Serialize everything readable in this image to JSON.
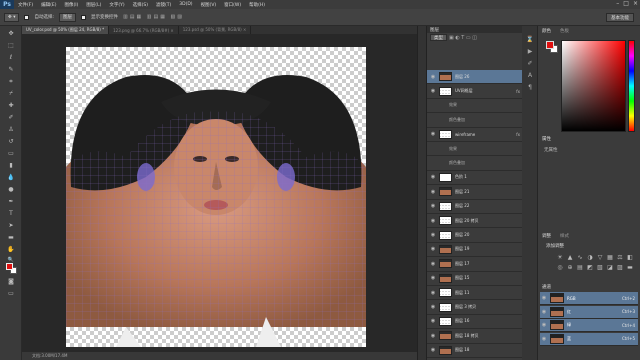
{
  "menubar": {
    "logo": "Ps",
    "items": [
      "文件(F)",
      "编辑(E)",
      "图像(I)",
      "图层(L)",
      "文字(Y)",
      "选择(S)",
      "滤镜(T)",
      "3D(D)",
      "视图(V)",
      "窗口(W)",
      "帮助(H)"
    ]
  },
  "options": {
    "auto_select": "自动选择:",
    "auto_select_target": "图层",
    "show_transform": "显示变换控件",
    "essentials": "基本功能"
  },
  "tabs": [
    {
      "label": "UV_color.psd @ 50% (图层 24, RGB/8) *",
      "active": true
    },
    {
      "label": "123.png @ 66.7% (RGB/8#) ×",
      "active": false
    },
    {
      "label": "123.psd @ 50% (背景, RGB/8) ×",
      "active": false
    }
  ],
  "status": {
    "doc_size": "文档:3.00M/17.4M"
  },
  "layers_panel": {
    "title": "图层",
    "filter_label": "类型",
    "layers": [
      {
        "name": "图层 26",
        "thumb": "face",
        "fx": "",
        "selected": true
      },
      {
        "name": "UV网格层",
        "thumb": "chk",
        "fx": "fx"
      },
      {
        "name": "效果",
        "thumb": "",
        "fx": "",
        "sub": true
      },
      {
        "name": "颜色叠加",
        "thumb": "",
        "fx": "",
        "sub": true
      },
      {
        "name": "wireframe",
        "thumb": "chk",
        "fx": "fx"
      },
      {
        "name": "效果",
        "thumb": "",
        "fx": "",
        "sub": true
      },
      {
        "name": "颜色叠加",
        "thumb": "",
        "fx": "",
        "sub": true
      },
      {
        "name": "色阶 1",
        "thumb": "white",
        "fx": ""
      },
      {
        "name": "图层 21",
        "thumb": "face",
        "fx": ""
      },
      {
        "name": "图层 22",
        "thumb": "chk",
        "fx": ""
      },
      {
        "name": "图层 20 拷贝",
        "thumb": "chk",
        "fx": ""
      },
      {
        "name": "图层 20",
        "thumb": "chk",
        "fx": ""
      },
      {
        "name": "图层 19",
        "thumb": "face",
        "fx": ""
      },
      {
        "name": "图层 17",
        "thumb": "face",
        "fx": ""
      },
      {
        "name": "图层 15",
        "thumb": "face",
        "fx": ""
      },
      {
        "name": "图层 11",
        "thumb": "chk",
        "fx": ""
      },
      {
        "name": "图层 3 拷贝",
        "thumb": "chk",
        "fx": ""
      },
      {
        "name": "图层 16",
        "thumb": "chk",
        "fx": ""
      },
      {
        "name": "图层 18 拷贝",
        "thumb": "face",
        "fx": ""
      },
      {
        "name": "图层 18",
        "thumb": "face",
        "fx": ""
      }
    ]
  },
  "right_panel": {
    "color_title": "颜色",
    "swatch_title": "色板",
    "props_title": "属性",
    "props_value": "无属性",
    "adjust_title": "调整",
    "styles_title": "样式",
    "adjust_add": "添加调整",
    "channels_title": "通道",
    "channels": [
      {
        "name": "RGB",
        "key": "Ctrl+2"
      },
      {
        "name": "红",
        "key": "Ctrl+3"
      },
      {
        "name": "绿",
        "key": "Ctrl+4"
      },
      {
        "name": "蓝",
        "key": "Ctrl+5"
      }
    ]
  },
  "colors": {
    "foreground": "#e01010",
    "background": "#ffffff",
    "selection": "#5b7796"
  }
}
